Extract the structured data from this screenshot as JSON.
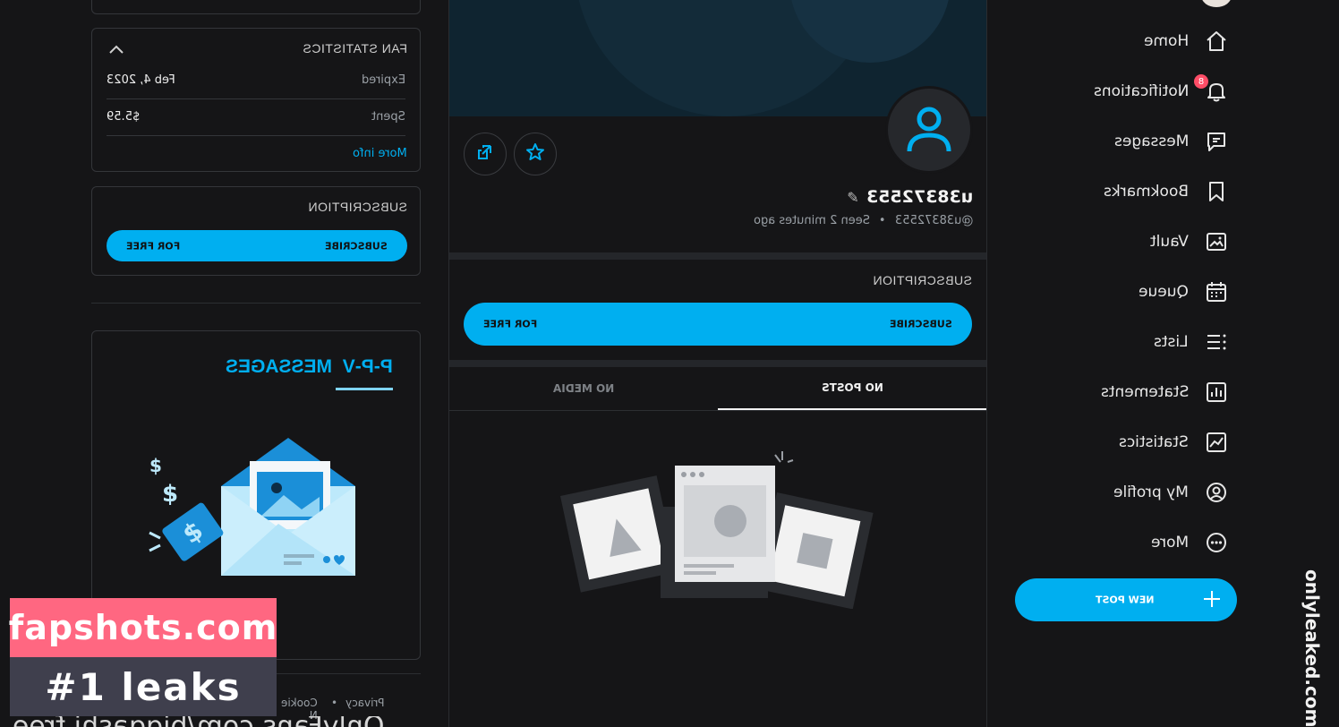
{
  "fan_statistics": {
    "title": "FAN STATISTICS",
    "rows": [
      {
        "label": "Expired",
        "value": "Feb 4, 2023"
      },
      {
        "label": "Spent",
        "value": "$5.59"
      }
    ],
    "more_info": "More info"
  },
  "left_subscription": {
    "title": "SUBSCRIPTION",
    "subscribe": "SUBSCRIBE",
    "price": "FOR FREE"
  },
  "promo": {
    "title": "P-P-V  MESSAGES"
  },
  "footer": {
    "privacy": "Privacy",
    "cookie": "Cookie N",
    "url_partial": "OnlyFans.com/biggashi free"
  },
  "profile": {
    "name": "u38372553",
    "handle": "@u38372553",
    "seen": "Seen 2 minutes ago"
  },
  "subscription": {
    "title": "SUBSCRIPTION",
    "subscribe": "SUBSCRIBE",
    "price": "FOR FREE"
  },
  "tabs": [
    {
      "label": "NO POSTS",
      "active": true
    },
    {
      "label": "NO MEDIA",
      "active": false
    }
  ],
  "nav": {
    "items": [
      {
        "label": "Home",
        "icon": "home-icon"
      },
      {
        "label": "Notifications",
        "icon": "bell-icon",
        "badge": "8"
      },
      {
        "label": "Messages",
        "icon": "message-icon"
      },
      {
        "label": "Bookmarks",
        "icon": "bookmark-icon"
      },
      {
        "label": "Vault",
        "icon": "vault-icon"
      },
      {
        "label": "Queue",
        "icon": "calendar-icon"
      },
      {
        "label": "Lists",
        "icon": "lists-icon"
      },
      {
        "label": "Statements",
        "icon": "statements-icon"
      },
      {
        "label": "Statistics",
        "icon": "statistics-icon"
      },
      {
        "label": "My profile",
        "icon": "profile-icon"
      },
      {
        "label": "More",
        "icon": "more-icon"
      }
    ],
    "new_post": "NEW POST"
  },
  "watermark": {
    "line1": "fapshots.com",
    "line2": "#1 leaks",
    "side": "onlyleaked.com"
  },
  "colors": {
    "accent": "#00aff0",
    "background": "#151517",
    "badge": "#ff4d67",
    "watermark_pink": "#ff6781"
  }
}
